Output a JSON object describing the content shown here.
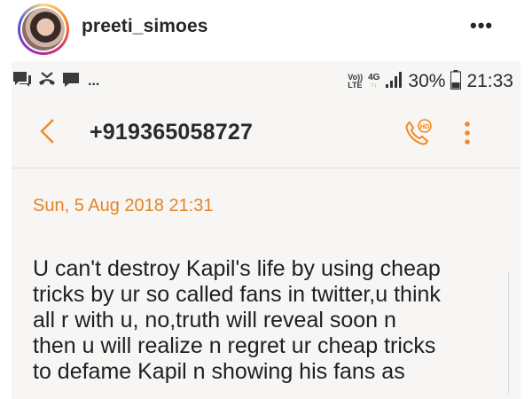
{
  "instagram": {
    "username": "preeti_simoes",
    "more_label": "•••"
  },
  "statusbar": {
    "left_icons": [
      "chat-icon",
      "missed-call-icon",
      "message-icon"
    ],
    "overflow": "...",
    "volte_line1": "Vo))",
    "volte_line2": "LTE",
    "network_type": "4G",
    "network_arrows": "↑↓",
    "battery_percent": "30%",
    "time": "21:33"
  },
  "toolbar": {
    "back_glyph": "<",
    "contact_number": "+919365058727",
    "call_badge": "HD"
  },
  "message": {
    "date": "Sun, 5 Aug 2018 21:31",
    "body": "U can't destroy Kapil's life by using cheap\ntricks by ur so called fans in twitter,u think\nall r with u, no,truth will reveal soon n\nthen u will realize n regret ur cheap tricks\nto defame Kapil n showing his fans as"
  },
  "colors": {
    "accent": "#f08a24",
    "date": "#e48427",
    "text": "#1f1f1f",
    "screen_bg": "#f7f6f4"
  }
}
